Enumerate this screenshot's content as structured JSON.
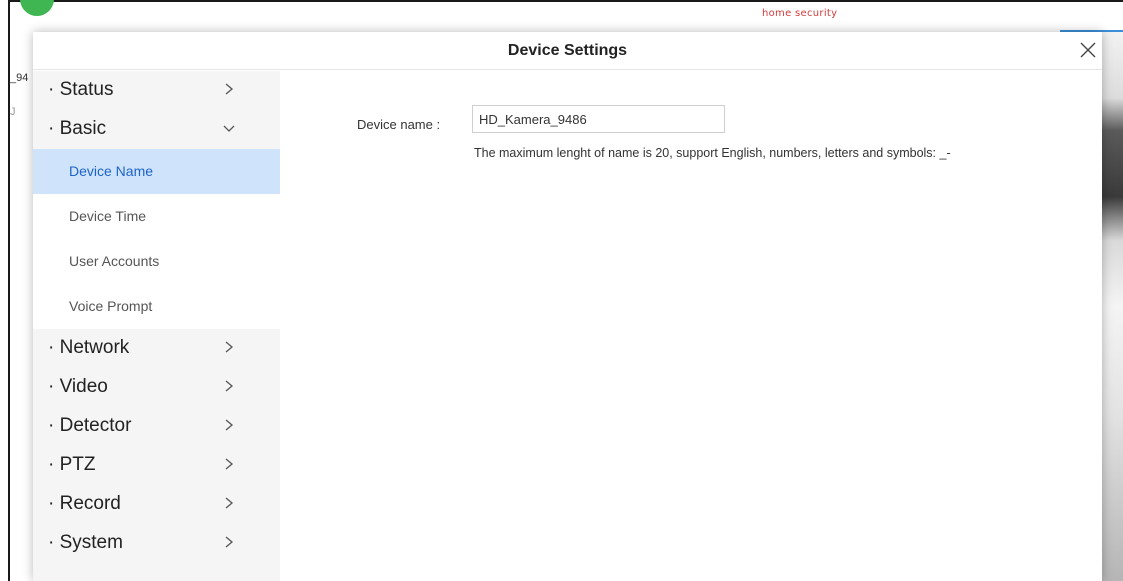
{
  "background": {
    "brand_text": "home security",
    "left_text_1": "_94",
    "left_text_2": "J"
  },
  "dialog": {
    "title": "Device Settings",
    "close_icon": "close-icon"
  },
  "sidebar": {
    "items": [
      {
        "label": "· Status",
        "icon": "chevron-right-icon"
      },
      {
        "label": "· Basic",
        "icon": "chevron-down-icon",
        "children": [
          {
            "label": "Device Name",
            "active": true
          },
          {
            "label": "Device Time"
          },
          {
            "label": "User Accounts"
          },
          {
            "label": "Voice Prompt"
          }
        ]
      },
      {
        "label": "· Network",
        "icon": "chevron-right-icon"
      },
      {
        "label": "· Video",
        "icon": "chevron-right-icon"
      },
      {
        "label": "· Detector",
        "icon": "chevron-right-icon"
      },
      {
        "label": "· PTZ",
        "icon": "chevron-right-icon"
      },
      {
        "label": "· Record",
        "icon": "chevron-right-icon"
      },
      {
        "label": "· System",
        "icon": "chevron-right-icon"
      }
    ]
  },
  "main": {
    "device_name_label": "Device name :",
    "device_name_value": "HD_Kamera_9486",
    "hint": "The maximum lenght of name is 20, support English, numbers, letters and symbols: _-"
  },
  "colors": {
    "active_bg": "#cfe4fb",
    "active_text": "#1e63c7",
    "sidebar_bg": "#f5f5f5",
    "brand_red": "#d23c3c",
    "logo_green": "#3fb652"
  }
}
